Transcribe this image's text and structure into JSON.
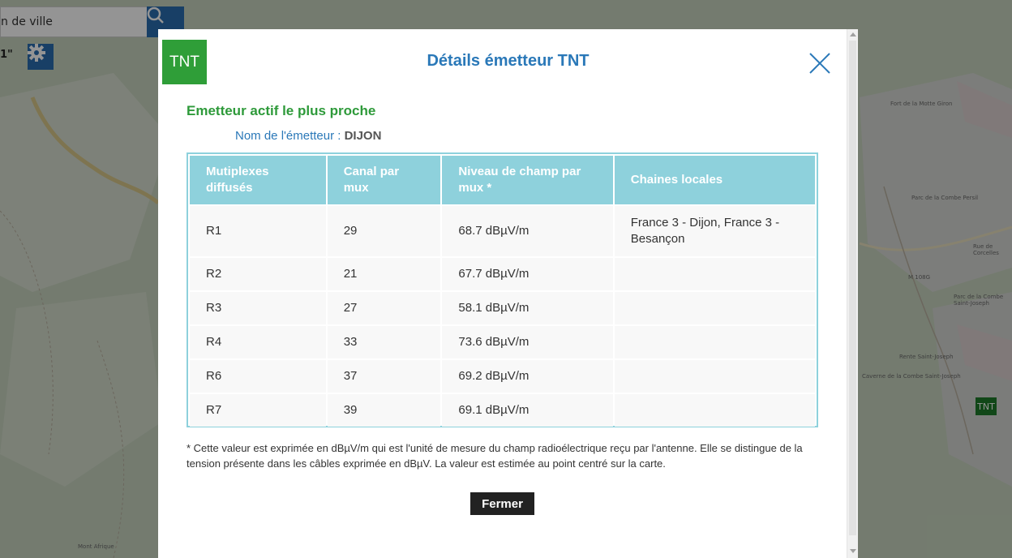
{
  "map": {
    "search_placeholder": "n de ville",
    "scale_text": "1\"",
    "tnt_marker_label": "TNT",
    "labels": [
      "Fort de la Motte Giron",
      "Parc de la Combe Persil",
      "Parc de la Combe Saint-Joseph",
      "Rente Saint-Joseph",
      "Caverne de la Combe Saint-Joseph",
      "Mont Afrique",
      "Rue de Corcelles",
      "M 108G"
    ]
  },
  "modal": {
    "logo_text": "TNT",
    "title": "Détails émetteur TNT",
    "section_title": "Emetteur actif le plus proche",
    "emitter_label": "Nom de l'émetteur :",
    "emitter_name": "DIJON",
    "table": {
      "headers": [
        "Mutiplexes diffusés",
        "Canal par mux",
        "Niveau de champ par mux *",
        "Chaines locales"
      ],
      "rows": [
        [
          "R1",
          "29",
          "68.7 dBµV/m",
          "France 3 - Dijon, France 3 - Besançon"
        ],
        [
          "R2",
          "21",
          "67.7 dBµV/m",
          ""
        ],
        [
          "R3",
          "27",
          "58.1 dBµV/m",
          ""
        ],
        [
          "R4",
          "33",
          "73.6 dBµV/m",
          ""
        ],
        [
          "R6",
          "37",
          "69.2 dBµV/m",
          ""
        ],
        [
          "R7",
          "39",
          "69.1 dBµV/m",
          ""
        ]
      ]
    },
    "footnote": "* Cette valeur est exprimée en dBµV/m qui est l'unité de mesure du champ radioélectrique reçu par l'antenne. Elle se distingue de la tension présente dans les câbles exprimée en dBµV. La valeur est estimée au point centré sur la carte.",
    "close_button": "Fermer"
  },
  "colors": {
    "accent_blue": "#2a78b8",
    "accent_green": "#2e9a3a",
    "table_header": "#8ed1dc"
  }
}
